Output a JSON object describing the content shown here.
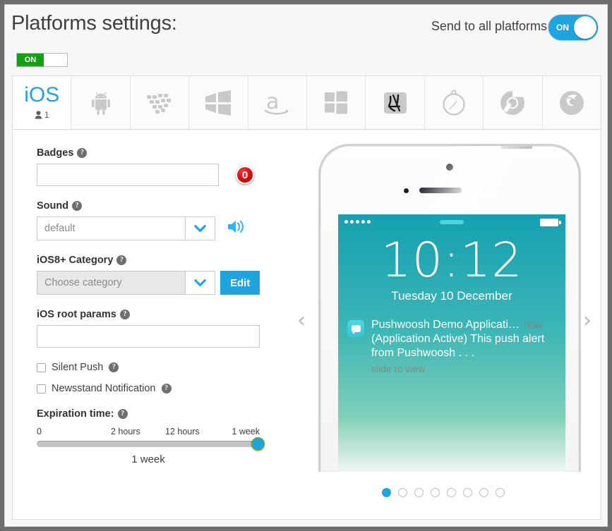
{
  "header": {
    "title": "Platforms settings:",
    "send_all_label": "Send to all platforms:",
    "send_all_state": "ON",
    "master_toggle_state": "ON",
    "accent_color": "#1fa4e0",
    "green_color": "#12a112"
  },
  "tabs": [
    {
      "id": "ios",
      "label": "iOS",
      "icon": "ios-text",
      "active": true,
      "user_count": "1",
      "user_icon": "person-icon"
    },
    {
      "id": "android",
      "label": "Android",
      "icon": "android-icon",
      "active": false
    },
    {
      "id": "blackberry",
      "label": "BlackBerry",
      "icon": "blackberry-icon",
      "active": false
    },
    {
      "id": "windows-phone",
      "label": "Windows Phone",
      "icon": "windows-phone-icon",
      "active": false
    },
    {
      "id": "amazon",
      "label": "Amazon",
      "icon": "amazon-icon",
      "active": false
    },
    {
      "id": "windows",
      "label": "Windows",
      "icon": "windows-icon",
      "active": false
    },
    {
      "id": "mac-os-x",
      "label": "Mac OS X",
      "icon": "finder-icon",
      "active": false
    },
    {
      "id": "safari",
      "label": "Safari",
      "icon": "safari-icon",
      "active": false
    },
    {
      "id": "chrome",
      "label": "Chrome",
      "icon": "chrome-icon",
      "active": false
    },
    {
      "id": "firefox",
      "label": "Firefox",
      "icon": "firefox-icon",
      "active": false
    }
  ],
  "form": {
    "badges": {
      "label": "Badges",
      "help": "?",
      "value": "",
      "placeholder": "",
      "badge_preview": "0"
    },
    "sound": {
      "label": "Sound",
      "help": "?",
      "value": "default",
      "speaker_icon": "speaker-icon"
    },
    "category": {
      "label": "iOS8+ Category",
      "help": "?",
      "value": "",
      "placeholder": "Choose category",
      "edit_label": "Edit"
    },
    "root_params": {
      "label": "iOS root params",
      "help": "?",
      "value": "",
      "placeholder": ""
    },
    "silent_push": {
      "label": "Silent Push",
      "help": "?",
      "checked": false
    },
    "newsstand": {
      "label": "Newsstand Notification",
      "help": "?",
      "checked": false
    },
    "expiration": {
      "label": "Expiration time:",
      "help": "?",
      "ticks": [
        "0",
        "2 hours",
        "12 hours",
        "1 week"
      ],
      "value": "1 week",
      "position_percent": 100
    }
  },
  "preview": {
    "prev_arrow": "‹",
    "next_arrow": "›",
    "status": {
      "signal_dots": 5,
      "battery": "full"
    },
    "lock_time": "10:12",
    "lock_date": "Tuesday 10 December",
    "notification": {
      "app_title": "Pushwoosh Demo Applicati…",
      "time": "now",
      "message": "(Application Active) This push alert from Pushwoosh . . .",
      "slide_hint": "slide to view",
      "app_icon": "message-bubble-icon"
    },
    "dots_total": 8,
    "dots_active_index": 0
  }
}
